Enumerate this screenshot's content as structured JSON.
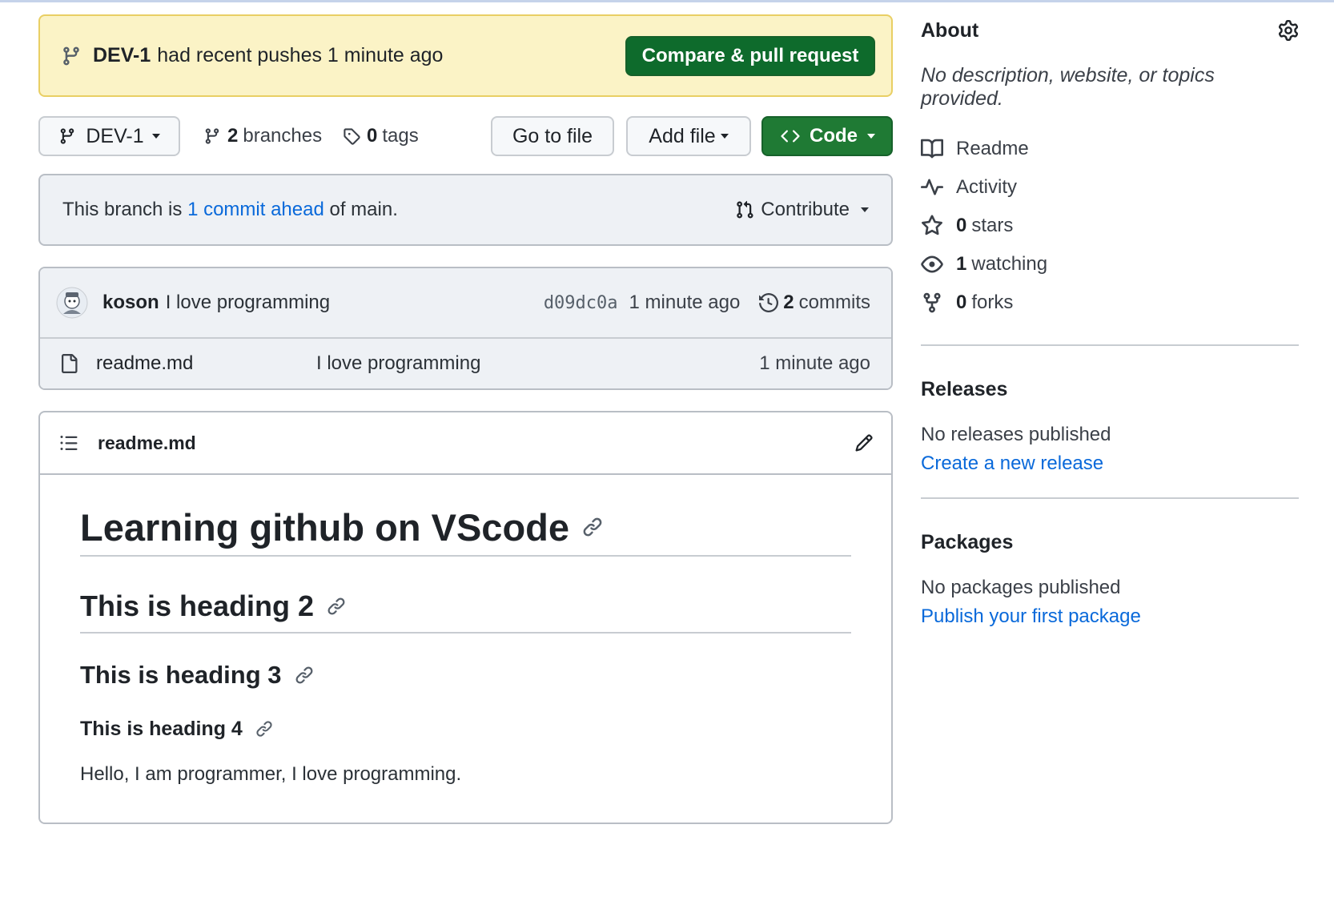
{
  "banner": {
    "branch": "DEV-1",
    "message": "had recent pushes 1 minute ago",
    "button": "Compare & pull request"
  },
  "toolbar": {
    "branch": "DEV-1",
    "branches_count": "2",
    "branches_label": "branches",
    "tags_count": "0",
    "tags_label": "tags",
    "go_to_file": "Go to file",
    "add_file": "Add file",
    "code": "Code"
  },
  "ahead": {
    "prefix": "This branch is",
    "link": "1 commit ahead",
    "suffix": "of main.",
    "contribute": "Contribute"
  },
  "commit": {
    "author": "koson",
    "message": "I love programming",
    "sha": "d09dc0a",
    "time": "1 minute ago",
    "count": "2",
    "count_label": "commits"
  },
  "files": [
    {
      "name": "readme.md",
      "commit": "I love programming",
      "time": "1 minute ago"
    }
  ],
  "readme": {
    "filename": "readme.md",
    "h1": "Learning github on VScode",
    "h2": "This is heading 2",
    "h3": "This is heading 3",
    "h4": "This is heading 4",
    "paragraph": "Hello, I am programmer, I love programming."
  },
  "about": {
    "title": "About",
    "description": "No description, website, or topics provided.",
    "items": [
      {
        "icon": "book-icon",
        "count": "",
        "label": "Readme"
      },
      {
        "icon": "pulse-icon",
        "count": "",
        "label": "Activity"
      },
      {
        "icon": "star-icon",
        "count": "0",
        "label": "stars"
      },
      {
        "icon": "eye-icon",
        "count": "1",
        "label": "watching"
      },
      {
        "icon": "fork-icon",
        "count": "0",
        "label": "forks"
      }
    ]
  },
  "releases": {
    "title": "Releases",
    "text": "No releases published",
    "link": "Create a new release"
  },
  "packages": {
    "title": "Packages",
    "text": "No packages published",
    "link": "Publish your first package"
  },
  "colors": {
    "accent_green": "#1f7a34",
    "link_blue": "#0969da",
    "banner_yellow": "#fbf3c6"
  }
}
